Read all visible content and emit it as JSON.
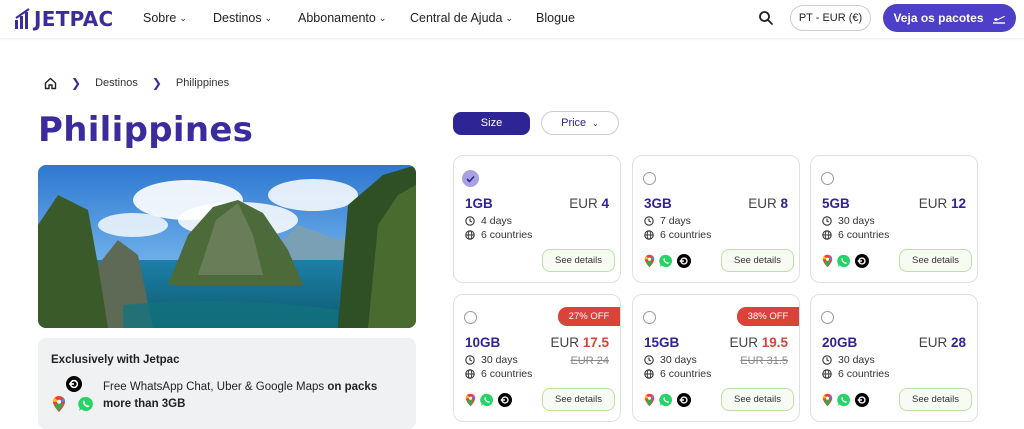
{
  "header": {
    "logo_text": "JETPAC",
    "nav": [
      {
        "label": "Sobre",
        "dropdown": true
      },
      {
        "label": "Destinos",
        "dropdown": true
      },
      {
        "label": "Abbonamento",
        "dropdown": true
      },
      {
        "label": "Central de Ajuda",
        "dropdown": true
      },
      {
        "label": "Blogue",
        "dropdown": false
      }
    ],
    "language": "PT - EUR (€)",
    "cta": "Veja os pacotes"
  },
  "breadcrumb": [
    "Destinos",
    "Philippines"
  ],
  "page_title": "Philippines",
  "exclusive": {
    "title": "Exclusively with Jetpac",
    "text_pre": "Free WhatsApp Chat, Uber & Google Maps ",
    "text_bold": "on packs more than 3GB"
  },
  "filters": {
    "size": "Size",
    "price": "Price"
  },
  "cards": [
    {
      "gb": "1GB",
      "currency": "EUR",
      "price": "4",
      "old_price": "",
      "badge": "",
      "days": "4 days",
      "countries": "6 countries",
      "selected": true,
      "apps": false,
      "details": "See details"
    },
    {
      "gb": "3GB",
      "currency": "EUR",
      "price": "8",
      "old_price": "",
      "badge": "",
      "days": "7 days",
      "countries": "6 countries",
      "selected": false,
      "apps": true,
      "details": "See details"
    },
    {
      "gb": "5GB",
      "currency": "EUR",
      "price": "12",
      "old_price": "",
      "badge": "",
      "days": "30 days",
      "countries": "6 countries",
      "selected": false,
      "apps": true,
      "details": "See details"
    },
    {
      "gb": "10GB",
      "currency": "EUR",
      "price": "17.5",
      "old_price": "EUR 24",
      "badge": "27% OFF",
      "days": "30 days",
      "countries": "6 countries",
      "selected": false,
      "apps": true,
      "details": "See details"
    },
    {
      "gb": "15GB",
      "currency": "EUR",
      "price": "19.5",
      "old_price": "EUR 31.5",
      "badge": "38% OFF",
      "days": "30 days",
      "countries": "6 countries",
      "selected": false,
      "apps": true,
      "details": "See details"
    },
    {
      "gb": "20GB",
      "currency": "EUR",
      "price": "28",
      "old_price": "",
      "badge": "",
      "days": "30 days",
      "countries": "6 countries",
      "selected": false,
      "apps": true,
      "details": "See details"
    }
  ],
  "colors": {
    "brand": "#3b2c9e",
    "cta": "#4d3fc7",
    "sale": "#d9433a",
    "details_border": "#b9e3a4"
  }
}
